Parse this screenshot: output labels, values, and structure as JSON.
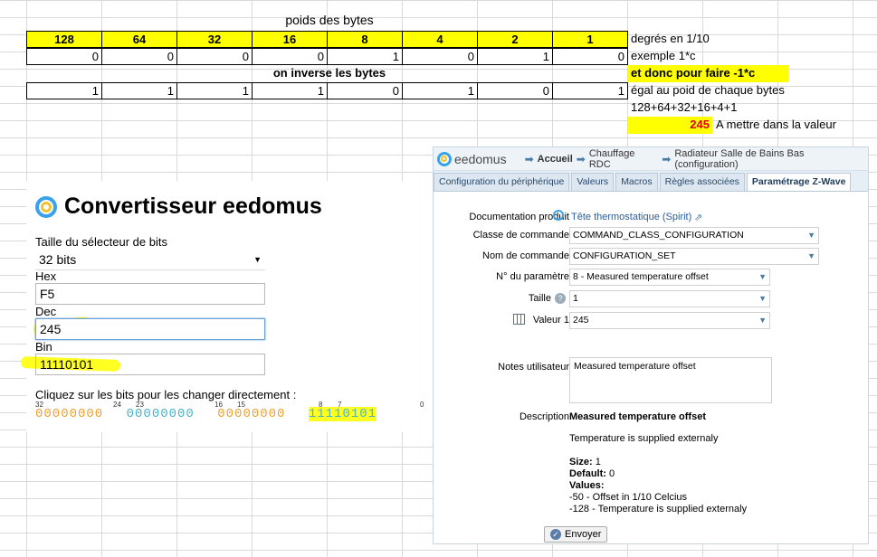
{
  "sheet": {
    "title": "poids des bytes",
    "weights": [
      "128",
      "64",
      "32",
      "16",
      "8",
      "4",
      "2",
      "1"
    ],
    "example_bits": [
      "0",
      "0",
      "0",
      "0",
      "1",
      "0",
      "1",
      "0"
    ],
    "invert_label": "on inverse les bytes",
    "inverted_bits": [
      "1",
      "1",
      "1",
      "1",
      "0",
      "1",
      "0",
      "1"
    ],
    "notes": {
      "degrees": "degrés en 1/10",
      "example": "exemple 1*c",
      "minus": "et donc pour faire -1*c",
      "equal": "égal au poid de chaque bytes",
      "sum": "128+64+32+16+4+1",
      "result": "245",
      "put_in": "A  mettre dans la valeur"
    }
  },
  "converter": {
    "title": "Convertisseur eedomus",
    "size_label": "Taille du sélecteur de bits",
    "size_value": "32 bits",
    "hex_label": "Hex",
    "hex_value": "F5",
    "dec_label": "Dec",
    "dec_value": "245",
    "bin_label": "Bin",
    "bin_value": "11110101",
    "click_label": "Cliquez sur les bits pour les changer directement :",
    "bit_indices": [
      "32",
      "24",
      "23",
      "16",
      "15",
      "8",
      "7",
      "0"
    ],
    "bit_groups": [
      "00000000",
      "00000000",
      "00000000",
      "11110101"
    ]
  },
  "panel": {
    "brand": "eedomus",
    "breadcrumb": [
      "Accueil",
      "Chauffage RDC",
      "Radiateur Salle de Bains Bas (configuration)"
    ],
    "tabs": [
      "Configuration du périphérique",
      "Valeurs",
      "Macros",
      "Règles associées",
      "Paramétrage Z-Wave"
    ],
    "fields": {
      "doc_label": "Documentation produit",
      "doc_value": "Tête thermostatique (Spirit)",
      "class_label": "Classe de commande",
      "class_value": "COMMAND_CLASS_CONFIGURATION",
      "cmd_label": "Nom de commande",
      "cmd_value": "CONFIGURATION_SET",
      "param_label": "N° du paramètre",
      "param_value": "8 - Measured temperature offset",
      "size_label": "Taille",
      "size_value": "1",
      "value_label": "Valeur 1",
      "value_value": "245",
      "notes_label": "Notes utilisateur",
      "notes_value": "Measured temperature offset",
      "desc_label": "Description",
      "desc_title": "Measured temperature offset",
      "desc_text": "Temperature is supplied externaly",
      "size_k": "Size:",
      "size_v": "1",
      "default_k": "Default:",
      "default_v": "0",
      "values_k": "Values:",
      "values_1": "-50 - Offset in 1/10 Celcius",
      "values_2": "-128 - Temperature is supplied externaly"
    },
    "send_label": "Envoyer"
  }
}
